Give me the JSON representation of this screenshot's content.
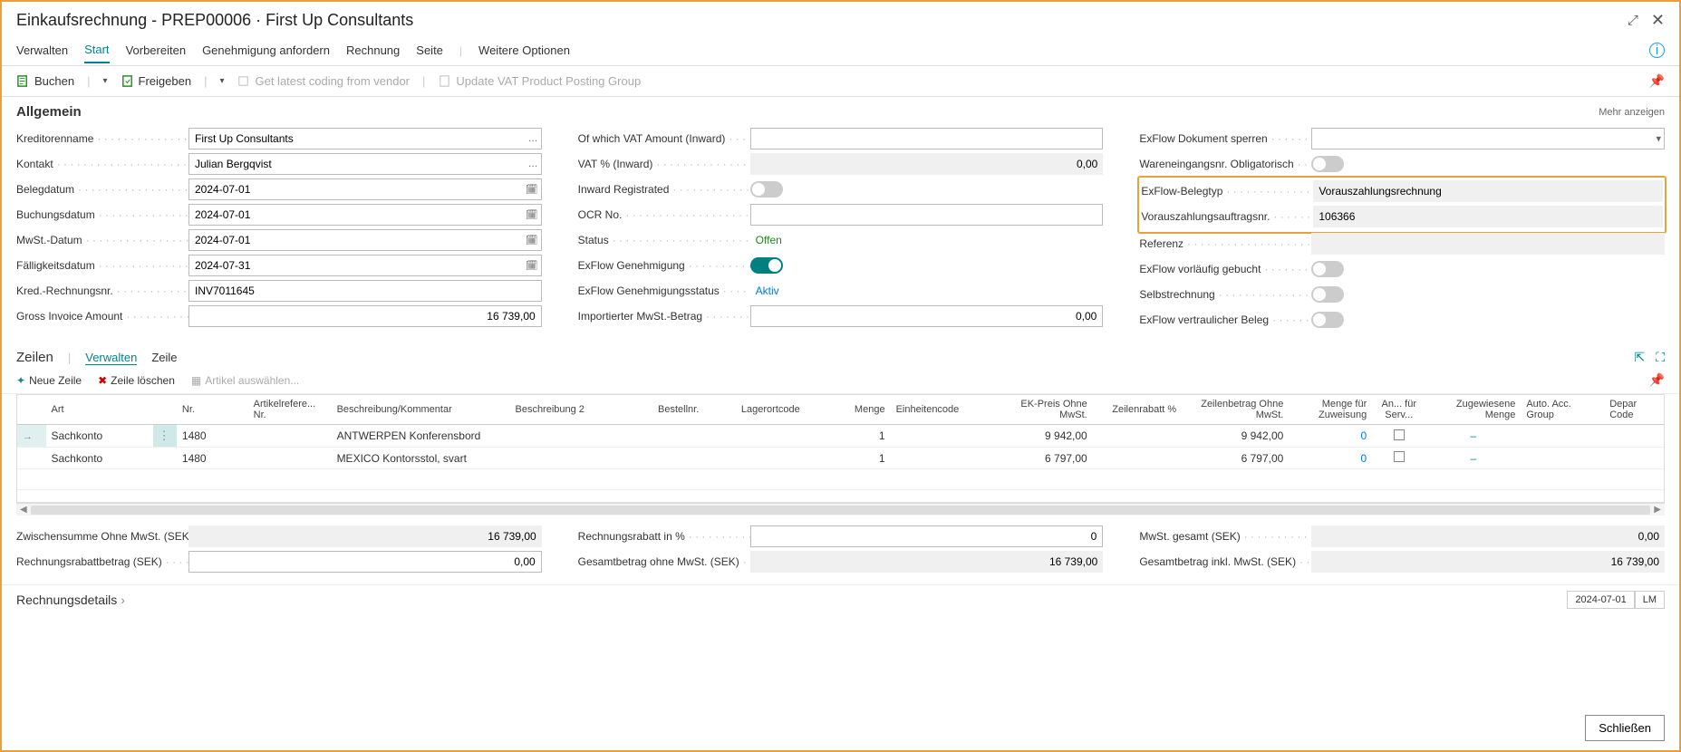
{
  "window": {
    "title": "Einkaufsrechnung - PREP00006 · First Up Consultants"
  },
  "tabs": {
    "verwalten": "Verwalten",
    "start": "Start",
    "vorbereiten": "Vorbereiten",
    "genehmigung": "Genehmigung anfordern",
    "rechnung": "Rechnung",
    "seite": "Seite",
    "weitere": "Weitere Optionen"
  },
  "toolbar": {
    "buchen": "Buchen",
    "freigeben": "Freigeben",
    "getcoding": "Get latest coding from vendor",
    "updatevat": "Update VAT Product Posting Group"
  },
  "section_allgemein": "Allgemein",
  "mehr": "Mehr anzeigen",
  "col1": {
    "kreditorenname_l": "Kreditorenname",
    "kreditorenname_v": "First Up Consultants",
    "kontakt_l": "Kontakt",
    "kontakt_v": "Julian Bergqvist",
    "belegdatum_l": "Belegdatum",
    "belegdatum_v": "2024-07-01",
    "buchungsdatum_l": "Buchungsdatum",
    "buchungsdatum_v": "2024-07-01",
    "mwstdatum_l": "MwSt.-Datum",
    "mwstdatum_v": "2024-07-01",
    "faelligkeit_l": "Fälligkeitsdatum",
    "faelligkeit_v": "2024-07-31",
    "kredrech_l": "Kred.-Rechnungsnr.",
    "kredrech_v": "INV7011645",
    "gross_l": "Gross Invoice Amount",
    "gross_v": "16 739,00"
  },
  "col2": {
    "vatamt_l": "Of which VAT Amount (Inward)",
    "vatamt_v": "",
    "vatpct_l": "VAT % (Inward)",
    "vatpct_v": "0,00",
    "inward_l": "Inward Registrated",
    "ocr_l": "OCR No.",
    "ocr_v": "",
    "status_l": "Status",
    "status_v": "Offen",
    "exflowgen_l": "ExFlow Genehmigung",
    "exflowgenstatus_l": "ExFlow Genehmigungsstatus",
    "exflowgenstatus_v": "Aktiv",
    "importmwst_l": "Importierter MwSt.-Betrag",
    "importmwst_v": "0,00"
  },
  "col3": {
    "exflowdok_l": "ExFlow Dokument sperren",
    "wareneing_l": "Wareneingangsnr. Obligatorisch",
    "exflowbeleg_l": "ExFlow-Belegtyp",
    "exflowbeleg_v": "Vorauszahlungsrechnung",
    "voraus_l": "Vorauszahlungsauftragsnr.",
    "voraus_v": "106366",
    "referenz_l": "Referenz",
    "referenz_v": "",
    "vorlaeufig_l": "ExFlow vorläufig gebucht",
    "selbst_l": "Selbstrechnung",
    "vertraulich_l": "ExFlow vertraulicher Beleg"
  },
  "lines": {
    "title": "Zeilen",
    "verwalten": "Verwalten",
    "zeile": "Zeile",
    "neue_zeile": "Neue Zeile",
    "zeile_loeschen": "Zeile löschen",
    "artikel_ausw": "Artikel auswählen..."
  },
  "cols": {
    "art": "Art",
    "nr": "Nr.",
    "artikelrefere": "Artikelrefere...\nNr.",
    "beschreibung": "Beschreibung/Kommentar",
    "beschreibung2": "Beschreibung 2",
    "bestellnr": "Bestellnr.",
    "lagerort": "Lagerortcode",
    "menge": "Menge",
    "einheit": "Einheitencode",
    "ekpreis": "EK-Preis Ohne MwSt.",
    "zeilenrabatt": "Zeilenrabatt %",
    "zeilenbetrag": "Zeilenbetrag Ohne MwSt.",
    "mengezuw": "Menge für Zuweisung",
    "anserv": "An... für Serv...",
    "zugewiesene": "Zugewiesene Menge",
    "autoacc": "Auto. Acc. Group",
    "depar": "Depar Code"
  },
  "rows": [
    {
      "art": "Sachkonto",
      "nr": "1480",
      "beschr": "ANTWERPEN Konferensbord",
      "menge": "1",
      "ekpreis": "9 942,00",
      "zeilenbetrag": "9 942,00",
      "mengezuw": "0"
    },
    {
      "art": "Sachkonto",
      "nr": "1480",
      "beschr": "MEXICO Kontorsstol, svart",
      "menge": "1",
      "ekpreis": "6 797,00",
      "zeilenbetrag": "6 797,00",
      "mengezuw": "0"
    }
  ],
  "totals": {
    "col1": {
      "zwischen_l": "Zwischensumme Ohne MwSt. (SEK)",
      "zwischen_v": "16 739,00",
      "rabattbetrag_l": "Rechnungsrabattbetrag (SEK)",
      "rabattbetrag_v": "0,00"
    },
    "col2": {
      "rabattpct_l": "Rechnungsrabatt in %",
      "rabattpct_v": "0",
      "gesamtohne_l": "Gesamtbetrag ohne MwSt. (SEK)",
      "gesamtohne_v": "16 739,00"
    },
    "col3": {
      "mwstges_l": "MwSt. gesamt (SEK)",
      "mwstges_v": "0,00",
      "gesamtinkl_l": "Gesamtbetrag inkl. MwSt. (SEK)",
      "gesamtinkl_v": "16 739,00"
    }
  },
  "details": {
    "title": "Rechnungsdetails",
    "date": "2024-07-01",
    "lm": "LM"
  },
  "footer": {
    "close": "Schließen"
  }
}
